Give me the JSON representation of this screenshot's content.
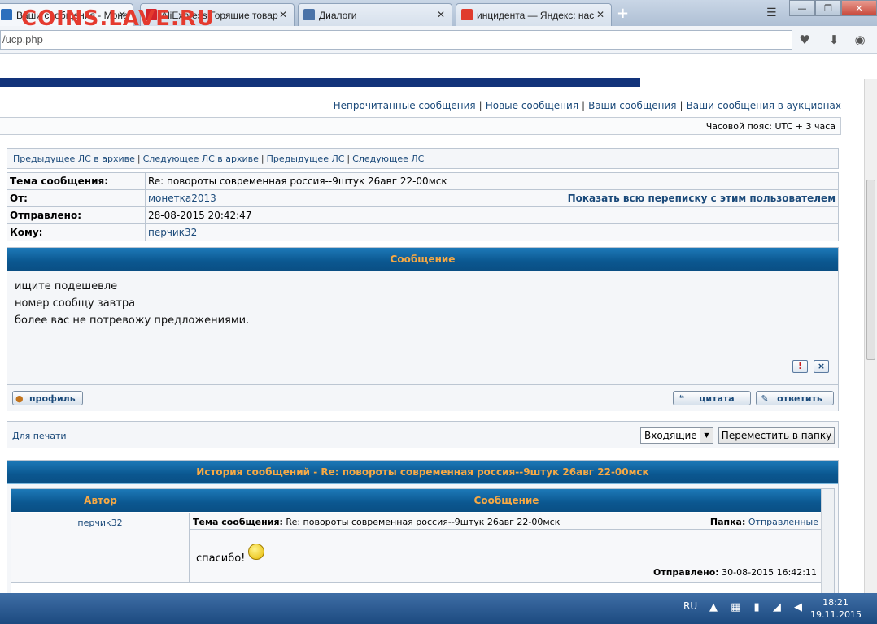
{
  "browser": {
    "tabs": [
      {
        "title": "Ваши сообщения - Моне",
        "icon_color": "#2d6fbd"
      },
      {
        "title": "AliExpress Горящие товар",
        "icon_color": "#d3232b"
      },
      {
        "title": "Диалоги",
        "icon_color": "#4b73a8"
      },
      {
        "title": "инцидента — Яндекс: нас",
        "icon_color": "#e03b2d"
      }
    ],
    "url": "/ucp.php",
    "watermark": "COINS.LAVE.RU"
  },
  "page": {
    "top_links": [
      "Непрочитанные сообщения",
      "Новые сообщения",
      "Ваши сообщения",
      "Ваши сообщения в аукционах"
    ],
    "timezone": "Часовой пояс: UTC + 3 часа",
    "nav_links": [
      "Предыдущее ЛС в архиве",
      "Следующее ЛС в архиве",
      "Предыдущее ЛС",
      "Следующее ЛС"
    ],
    "meta": {
      "subject_label": "Тема сообщения:",
      "subject": "Re: повороты современная россия--9штук 26авг 22-00мск",
      "from_label": "От:",
      "from": "монетка2013",
      "show_all": "Показать всю переписку с этим пользователем",
      "sent_label": "Отправлено:",
      "sent": "28-08-2015 20:42:47",
      "to_label": "Кому:",
      "to": "перчик32"
    },
    "message": {
      "header": "Сообщение",
      "lines": [
        "ищите подешевле",
        "номер сообщу завтра",
        "более вас не потревожу предложениями."
      ],
      "report_glyph": "!",
      "delete_glyph": "×",
      "profile_label": "профиль",
      "quote_label": "цитата",
      "reply_label": "ответить"
    },
    "print": {
      "link": "Для печати",
      "folder_selected": "Входящие",
      "move_button": "Переместить в папку"
    },
    "history": {
      "title": "История сообщений - Re: повороты современная россия--9штук 26авг 22-00мск",
      "col_author": "Автор",
      "col_message": "Сообщение",
      "entry": {
        "author": "перчик32",
        "subject_label": "Тема сообщения:",
        "subject": "Re: повороты современная россия--9штук 26авг 22-00мск",
        "folder_label": "Папка:",
        "folder": "Отправленные",
        "text": "спасибо!",
        "sent_label": "Отправлено:",
        "sent": "30-08-2015 16:42:11"
      }
    }
  },
  "taskbar": {
    "lang": "RU",
    "time": "18:21",
    "date": "19.11.2015"
  }
}
